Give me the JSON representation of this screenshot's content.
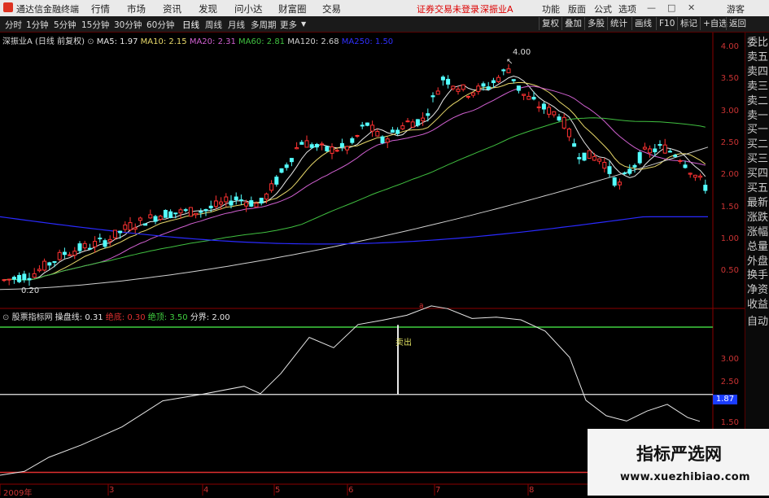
{
  "menubar": {
    "app_name": "通达信金融终端",
    "items": [
      "行情",
      "市场",
      "资讯",
      "发现",
      "问小达",
      "财富圈",
      "交易"
    ],
    "notice": "证券交易未登录",
    "stock": "深振业A",
    "right_items": [
      "功能",
      "版面",
      "公式",
      "选项"
    ],
    "guest": "游客"
  },
  "toolbar": {
    "periods": [
      "分时",
      "1分钟",
      "5分钟",
      "15分钟",
      "30分钟",
      "60分钟",
      "日线",
      "周线",
      "月线",
      "多周期",
      "更多"
    ],
    "right_buttons": [
      "复权",
      "叠加",
      "多股",
      "统计",
      "画线",
      "F10",
      "标记",
      "+自选",
      "返回"
    ]
  },
  "main_legend": {
    "stock": "深振业A",
    "mode": "(日线 前复权)",
    "ma": [
      {
        "label": "MA5: 1.97",
        "color": "#e8e8e8"
      },
      {
        "label": "MA10: 2.15",
        "color": "#e8d86a"
      },
      {
        "label": "MA20: 2.31",
        "color": "#d060d0"
      },
      {
        "label": "MA60: 2.81",
        "color": "#40c040"
      },
      {
        "label": "MA120: 2.68",
        "color": "#d0d0d0"
      },
      {
        "label": "MA250: 1.50",
        "color": "#3030ff"
      }
    ]
  },
  "main_annotations": {
    "high": "4.00",
    "low": "0.20"
  },
  "main_axis": [
    "4.00",
    "3.50",
    "3.00",
    "2.50",
    "2.00",
    "1.50",
    "1.00",
    "0.50"
  ],
  "indicator": {
    "name": "股票指标网",
    "lines": [
      {
        "label": "操盘线: 0.31",
        "color": "#e8e8e8"
      },
      {
        "label": "绝底: 0.30",
        "color": "#e03030"
      },
      {
        "label": "绝顶: 3.50",
        "color": "#40d040"
      },
      {
        "label": "分界: 2.00",
        "color": "#e8e8e8"
      }
    ],
    "signal": "卖出",
    "axis": [
      "3.00",
      "2.50",
      "1.50"
    ],
    "current": "1.87"
  },
  "x_axis": [
    "2009年",
    "3",
    "4",
    "5",
    "6",
    "7",
    "8"
  ],
  "side_panel": [
    "委比",
    "卖五",
    "卖四",
    "卖三",
    "卖二",
    "卖一",
    "买一",
    "买二",
    "买三",
    "买四",
    "买五",
    "最新",
    "涨跌",
    "涨幅",
    "总量",
    "外盘",
    "换手",
    "净资",
    "收益"
  ],
  "side_auto": "自动",
  "watermark": {
    "title": "指标严选网",
    "url": "www.xuezhibiao.com"
  },
  "colors": {
    "up": "#ff3232",
    "down": "#54ffff",
    "grid_red": "#8b0000"
  }
}
